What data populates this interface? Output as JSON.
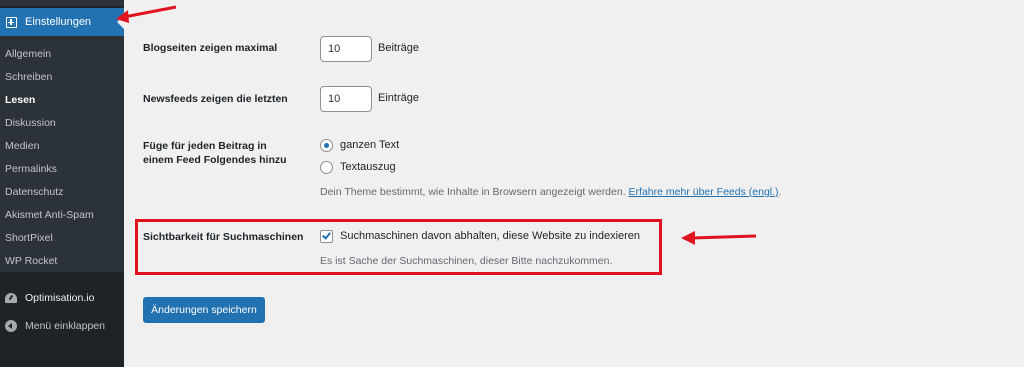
{
  "sidebar": {
    "active_menu": {
      "label": "Einstellungen",
      "icon": "settings-icon"
    },
    "submenu": [
      {
        "label": "Allgemein",
        "current": false
      },
      {
        "label": "Schreiben",
        "current": false
      },
      {
        "label": "Lesen",
        "current": true
      },
      {
        "label": "Diskussion",
        "current": false
      },
      {
        "label": "Medien",
        "current": false
      },
      {
        "label": "Permalinks",
        "current": false
      },
      {
        "label": "Datenschutz",
        "current": false
      },
      {
        "label": "Akismet Anti-Spam",
        "current": false
      },
      {
        "label": "ShortPixel",
        "current": false
      },
      {
        "label": "WP Rocket",
        "current": false
      }
    ],
    "optimisation": {
      "label": "Optimisation.io",
      "icon": "gauge-icon"
    },
    "collapse": {
      "label": "Menü einklappen",
      "icon": "collapse-arrow-icon"
    }
  },
  "settings": {
    "blog_pages": {
      "label": "Blogseiten zeigen maximal",
      "value": "10",
      "unit": "Beiträge"
    },
    "newsfeeds": {
      "label": "Newsfeeds zeigen die letzten",
      "value": "10",
      "unit": "Einträge"
    },
    "feed_content": {
      "label_line1": "Füge für jeden Beitrag in",
      "label_line2": "einem Feed Folgendes hinzu",
      "options": [
        {
          "label": "ganzen Text",
          "checked": true
        },
        {
          "label": "Textauszug",
          "checked": false
        }
      ],
      "description": "Dein Theme bestimmt, wie Inhalte in Browsern angezeigt werden.",
      "link_text": "Erfahre mehr über Feeds (engl.)",
      "link_suffix": "."
    },
    "search_visibility": {
      "label": "Sichtbarkeit für Suchmaschinen",
      "checkbox_label": "Suchmaschinen davon abhalten, diese Website zu indexieren",
      "checked": true,
      "description": "Es ist Sache der Suchmaschinen, dieser Bitte nachzukommen."
    }
  },
  "save_button": {
    "label": "Änderungen speichern"
  },
  "colors": {
    "accent": "#2271b1",
    "sidebar_bg": "#1d2327",
    "annotation_red": "#e0141e"
  }
}
